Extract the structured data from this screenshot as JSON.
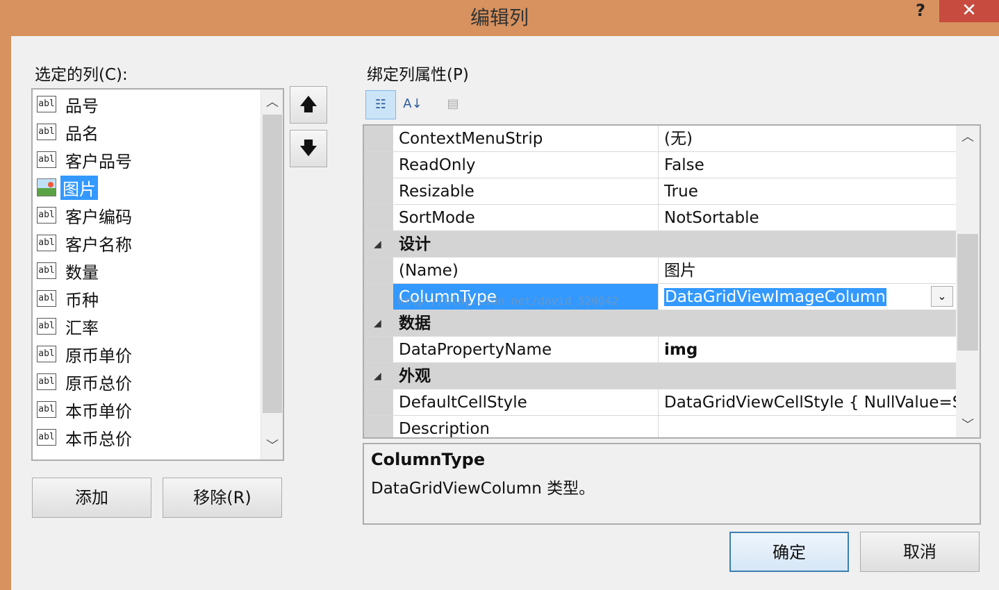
{
  "window": {
    "title": "编辑列",
    "help_label": "?",
    "close_label": "✕"
  },
  "left_panel": {
    "label": "选定的列(C):",
    "items": [
      {
        "icon": "abl-text-icon",
        "label": "品号"
      },
      {
        "icon": "abl-text-icon",
        "label": "品名"
      },
      {
        "icon": "abl-text-icon",
        "label": "客户品号"
      },
      {
        "icon": "image-column-icon",
        "label": "图片",
        "selected": true
      },
      {
        "icon": "abl-text-icon",
        "label": "客户编码"
      },
      {
        "icon": "abl-text-icon",
        "label": "客户名称"
      },
      {
        "icon": "abl-text-icon",
        "label": "数量"
      },
      {
        "icon": "abl-text-icon",
        "label": "币种"
      },
      {
        "icon": "abl-text-icon",
        "label": "汇率"
      },
      {
        "icon": "abl-text-icon",
        "label": "原币单价"
      },
      {
        "icon": "abl-text-icon",
        "label": "原币总价"
      },
      {
        "icon": "abl-text-icon",
        "label": "本币单价"
      },
      {
        "icon": "abl-text-icon",
        "label": "本币总价"
      }
    ],
    "abl_text": "abl",
    "add_button": "添加",
    "remove_button": "移除(R)"
  },
  "move_buttons": {
    "up": "🡅",
    "down": "🡇"
  },
  "right_panel": {
    "label": "绑定列属性(P)",
    "toolbar": {
      "categorized": "☷",
      "alphabetical": "A↓",
      "property_pages": "▤"
    },
    "rows": [
      {
        "type": "prop",
        "name": "ContextMenuStrip",
        "value": "(无)"
      },
      {
        "type": "prop",
        "name": "ReadOnly",
        "value": "False"
      },
      {
        "type": "prop",
        "name": "Resizable",
        "value": "True"
      },
      {
        "type": "prop",
        "name": "SortMode",
        "value": "NotSortable"
      },
      {
        "type": "category",
        "name": "设计"
      },
      {
        "type": "prop",
        "name": "(Name)",
        "value": "图片"
      },
      {
        "type": "prop",
        "name": "ColumnType",
        "value": "DataGridViewImageColumn",
        "selected": true
      },
      {
        "type": "category",
        "name": "数据"
      },
      {
        "type": "prop",
        "name": "DataPropertyName",
        "value": "img",
        "bold": true
      },
      {
        "type": "category",
        "name": "外观"
      },
      {
        "type": "prop",
        "name": "DefaultCellStyle",
        "value": "DataGridViewCellStyle { NullValue=S"
      },
      {
        "type": "prop",
        "name": "Description",
        "value": ""
      }
    ],
    "watermark": "http://blog.csdn.net/david_520042",
    "description": {
      "title": "ColumnType",
      "text": "DataGridViewColumn 类型。"
    }
  },
  "footer": {
    "ok_button": "确定",
    "cancel_button": "取消"
  }
}
